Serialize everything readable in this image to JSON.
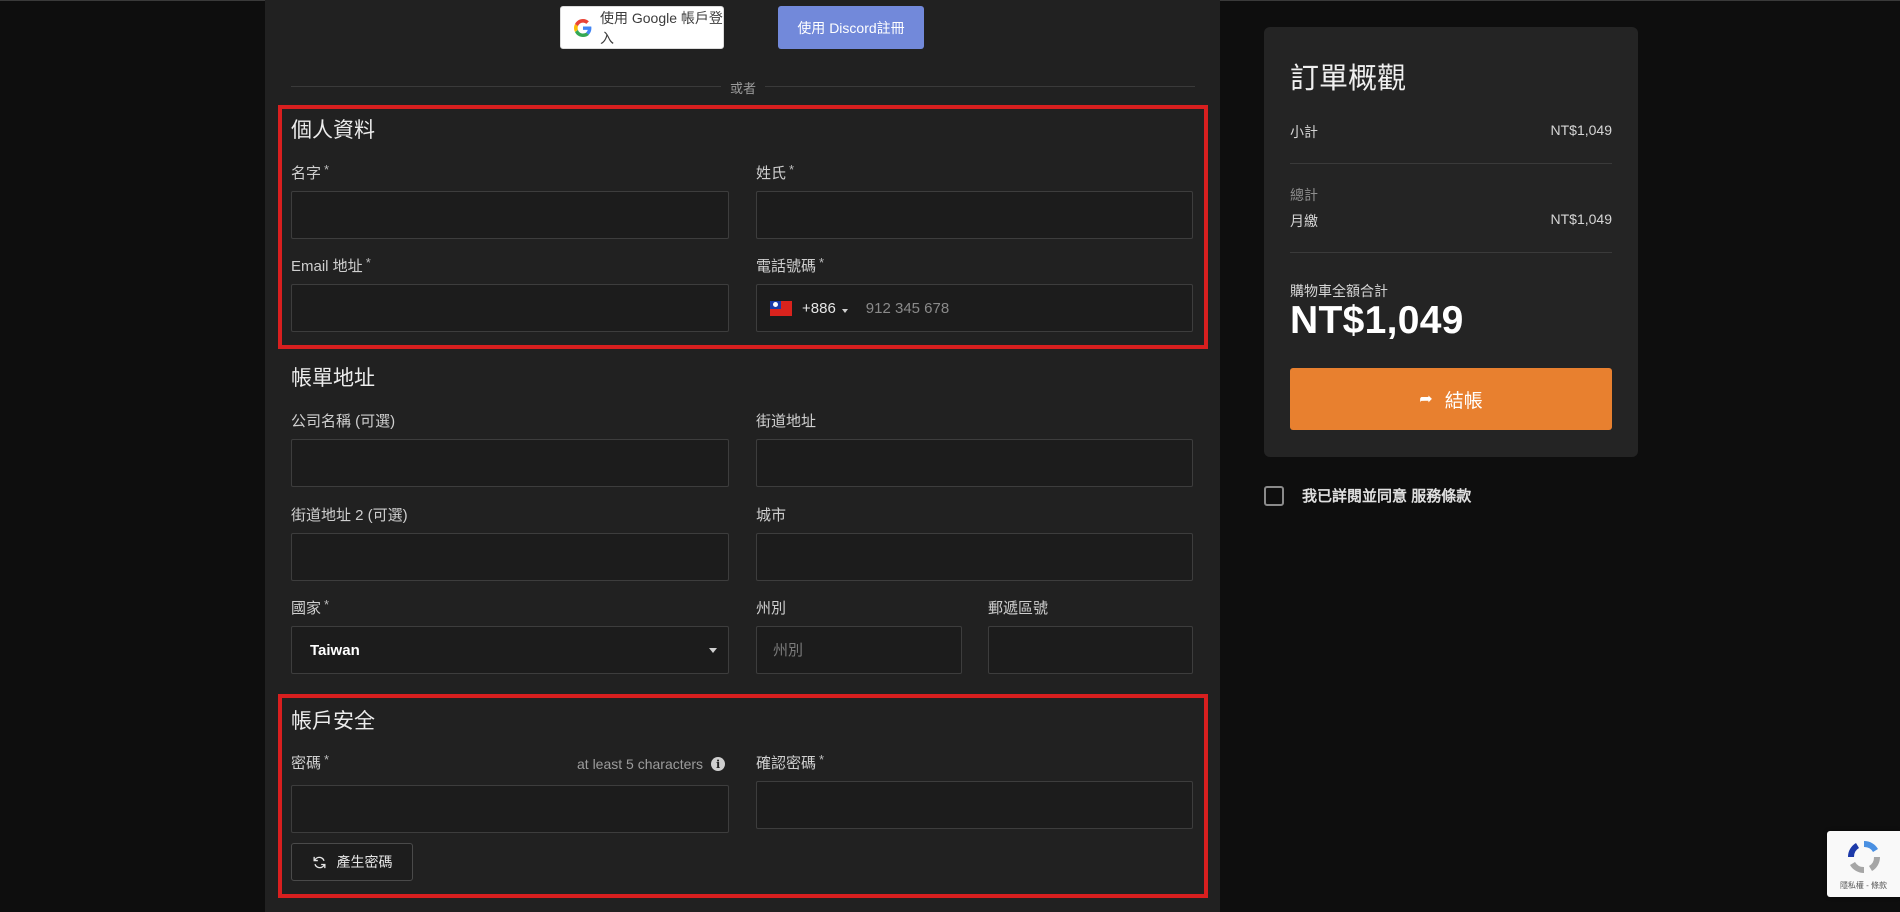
{
  "social": {
    "google_label": "使用 Google 帳戶登入",
    "discord_label": "使用 Discord註冊"
  },
  "divider_text": "或者",
  "personal": {
    "title": "個人資料",
    "first_name_label": "名字",
    "last_name_label": "姓氏",
    "email_label": "Email 地址",
    "phone_label": "電話號碼",
    "phone_code": "+886",
    "phone_placeholder": "912 345 678",
    "required_mark": "*"
  },
  "billing": {
    "title": "帳單地址",
    "company_label": "公司名稱 (可選)",
    "street_label": "街道地址",
    "street2_label": "街道地址 2 (可選)",
    "city_label": "城市",
    "country_label": "國家",
    "country_value": "Taiwan",
    "state_label": "州別",
    "state_placeholder": "州別",
    "postcode_label": "郵遞區號"
  },
  "security": {
    "title": "帳戶安全",
    "password_label": "密碼",
    "password_hint": "at least 5 characters",
    "confirm_label": "確認密碼",
    "generate_label": "產生密碼"
  },
  "summary": {
    "title": "訂單概觀",
    "subtotal_label": "小計",
    "subtotal_value": "NT$1,049",
    "totals_label": "總計",
    "monthly_label": "月繳",
    "monthly_value": "NT$1,049",
    "cart_total_label": "購物車全額合計",
    "cart_total_value": "NT$1,049",
    "checkout_label": "結帳"
  },
  "terms": {
    "prefix": "我已詳閱並同意",
    "link": "服務條款"
  },
  "recaptcha_text": "隱私權 - 條款",
  "colors": {
    "panel": "#212121",
    "highlight": "#d81f1f",
    "checkout": "#e8802f",
    "discord": "#7289da"
  }
}
